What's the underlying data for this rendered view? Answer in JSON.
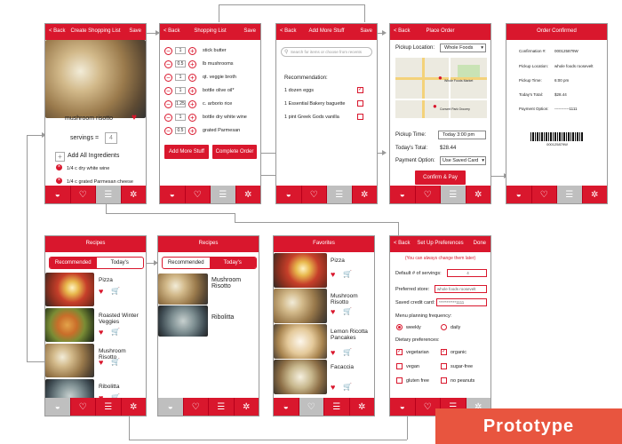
{
  "screens": {
    "create": {
      "back": "Back",
      "title": "Create Shopping List",
      "save": "Save",
      "recipe": "mushroom risotto",
      "servings_label": "servings =",
      "servings_value": "4",
      "add_all": "Add All Ingredients",
      "items": [
        "1/4 c dry white wine",
        "1/4 c grated Parmesan cheese"
      ]
    },
    "shopping": {
      "back": "Back",
      "title": "Shopping List",
      "save": "Save",
      "rows": [
        {
          "qty": "1",
          "name": "stick butter"
        },
        {
          "qty": "0.5",
          "name": "lb mushrooms"
        },
        {
          "qty": "1",
          "name": "qt. veggie broth"
        },
        {
          "qty": "1",
          "name": "bottle olive oil*"
        },
        {
          "qty": "1.25",
          "name": "c. arborio rice"
        },
        {
          "qty": "1",
          "name": "bottle dry white wine"
        },
        {
          "qty": "0.5",
          "name": "grated Parmesan"
        }
      ],
      "add_more": "Add More Stuff",
      "complete": "Complete Order"
    },
    "addmore": {
      "back": "Back",
      "title": "Add More Stuff",
      "save": "Save",
      "search_placeholder": "Search for items or choose from recents",
      "rec_label": "Recommendation:",
      "recs": [
        {
          "name": "1 dozen eggs",
          "checked": true
        },
        {
          "name": "1 Essential Bakery baguette",
          "checked": false
        },
        {
          "name": "1 pint Greek Gods vanilla",
          "checked": false
        }
      ]
    },
    "place": {
      "back": "Back",
      "title": "Place Order",
      "loc_label": "Pickup Location:",
      "loc_value": "Whole Foods",
      "map_pin1": "Whole Foods Market",
      "map_pin2": "Convert Park Grocery",
      "time_label": "Pickup Time:",
      "time_value": "Today 3:00 pm",
      "total_label": "Today's Total:",
      "total_value": "$28.44",
      "pay_label": "Payment Option:",
      "pay_value": "Use Saved Card",
      "confirm": "Confirm & Pay"
    },
    "confirmed": {
      "title": "Order Confirmed",
      "rows": [
        {
          "label": "Confirmation #:",
          "value": "000125879W"
        },
        {
          "label": "Pickup Location:",
          "value": "whole foods roosevelt"
        },
        {
          "label": "Pickup Time:",
          "value": "6:00 pm"
        },
        {
          "label": "Today's Total:",
          "value": "$28.44"
        },
        {
          "label": "Payment Option:",
          "value": "-----------1111"
        }
      ],
      "barcode": "000125879W"
    },
    "recipes1": {
      "title": "Recipes",
      "tabs": [
        "Recommended",
        "Today's"
      ],
      "items": [
        "Pizza",
        "Roasted Winter Veggies",
        "Mushroom Risotto",
        "Ribolitta"
      ]
    },
    "recipes2": {
      "title": "Recipes",
      "tabs": [
        "Recommended",
        "Today's"
      ],
      "items": [
        "Mushroom Risotto",
        "Ribolitta"
      ]
    },
    "favorites": {
      "title": "Favorites",
      "items": [
        "Pizza",
        "Mushroom Risotto",
        "Lemon Ricotta Pancakes",
        "Facaccia"
      ]
    },
    "prefs": {
      "back": "Back",
      "title": "Set Up Preferences",
      "done": "Done",
      "hint": "(You can always change them later)",
      "servings_label": "Default # of servings:",
      "servings_value": "4",
      "store_label": "Preferred store:",
      "store_value": "whole foods roosevelt",
      "card_label": "Saved credit card:",
      "card_value": "***********1111",
      "freq_label": "Menu planning frequency:",
      "freq": [
        "weekly",
        "daily"
      ],
      "diet_label": "Dietary preferences:",
      "diet": [
        {
          "name": "vegetarian",
          "checked": true
        },
        {
          "name": "organic",
          "checked": true
        },
        {
          "name": "vegan",
          "checked": false
        },
        {
          "name": "sugar-free",
          "checked": false
        },
        {
          "name": "gluten free",
          "checked": false
        },
        {
          "name": "no peanuts",
          "checked": false
        }
      ]
    }
  },
  "banner": "Prototype",
  "colors": {
    "accent": "#d9172d",
    "banner": "#e8553f"
  }
}
